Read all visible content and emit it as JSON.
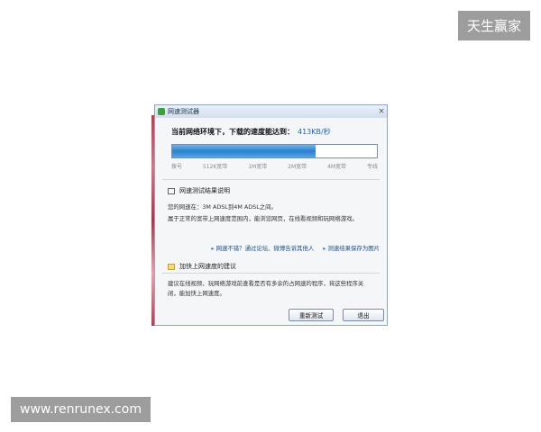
{
  "watermarks": {
    "top_right": "天生赢家",
    "bottom_left": "www.renrunex.com"
  },
  "window": {
    "title": "网速测试器",
    "close_label": "×"
  },
  "result": {
    "headline": "当前网络环境下，下载的速度能达到：",
    "speed": "413KB/秒",
    "progress_fraction": 0.7,
    "ticks": [
      "拨号",
      "512K宽带",
      "1M宽带",
      "2M宽带",
      "4M宽带",
      "专线"
    ]
  },
  "explanation": {
    "heading": "网速测试结果说明",
    "line1": "您的网速在：3M ADSL到4M ADSL之间。",
    "line2": "属于正常的宽带上网速度范围内，能浏览网页，在线看视频和玩网络游戏。"
  },
  "links": {
    "share": "网速不错？通过论坛、微博告诉其他人",
    "save": "测速结果保存为图片"
  },
  "tips": {
    "heading": "加快上网速度的建议",
    "line1": "建议在线视频、玩网络游戏前查看是否有多余的占网速的程序，将这些程序关",
    "line2": "闭，能加快上网速度。"
  },
  "buttons": {
    "retest": "重新测试",
    "exit": "退出"
  }
}
